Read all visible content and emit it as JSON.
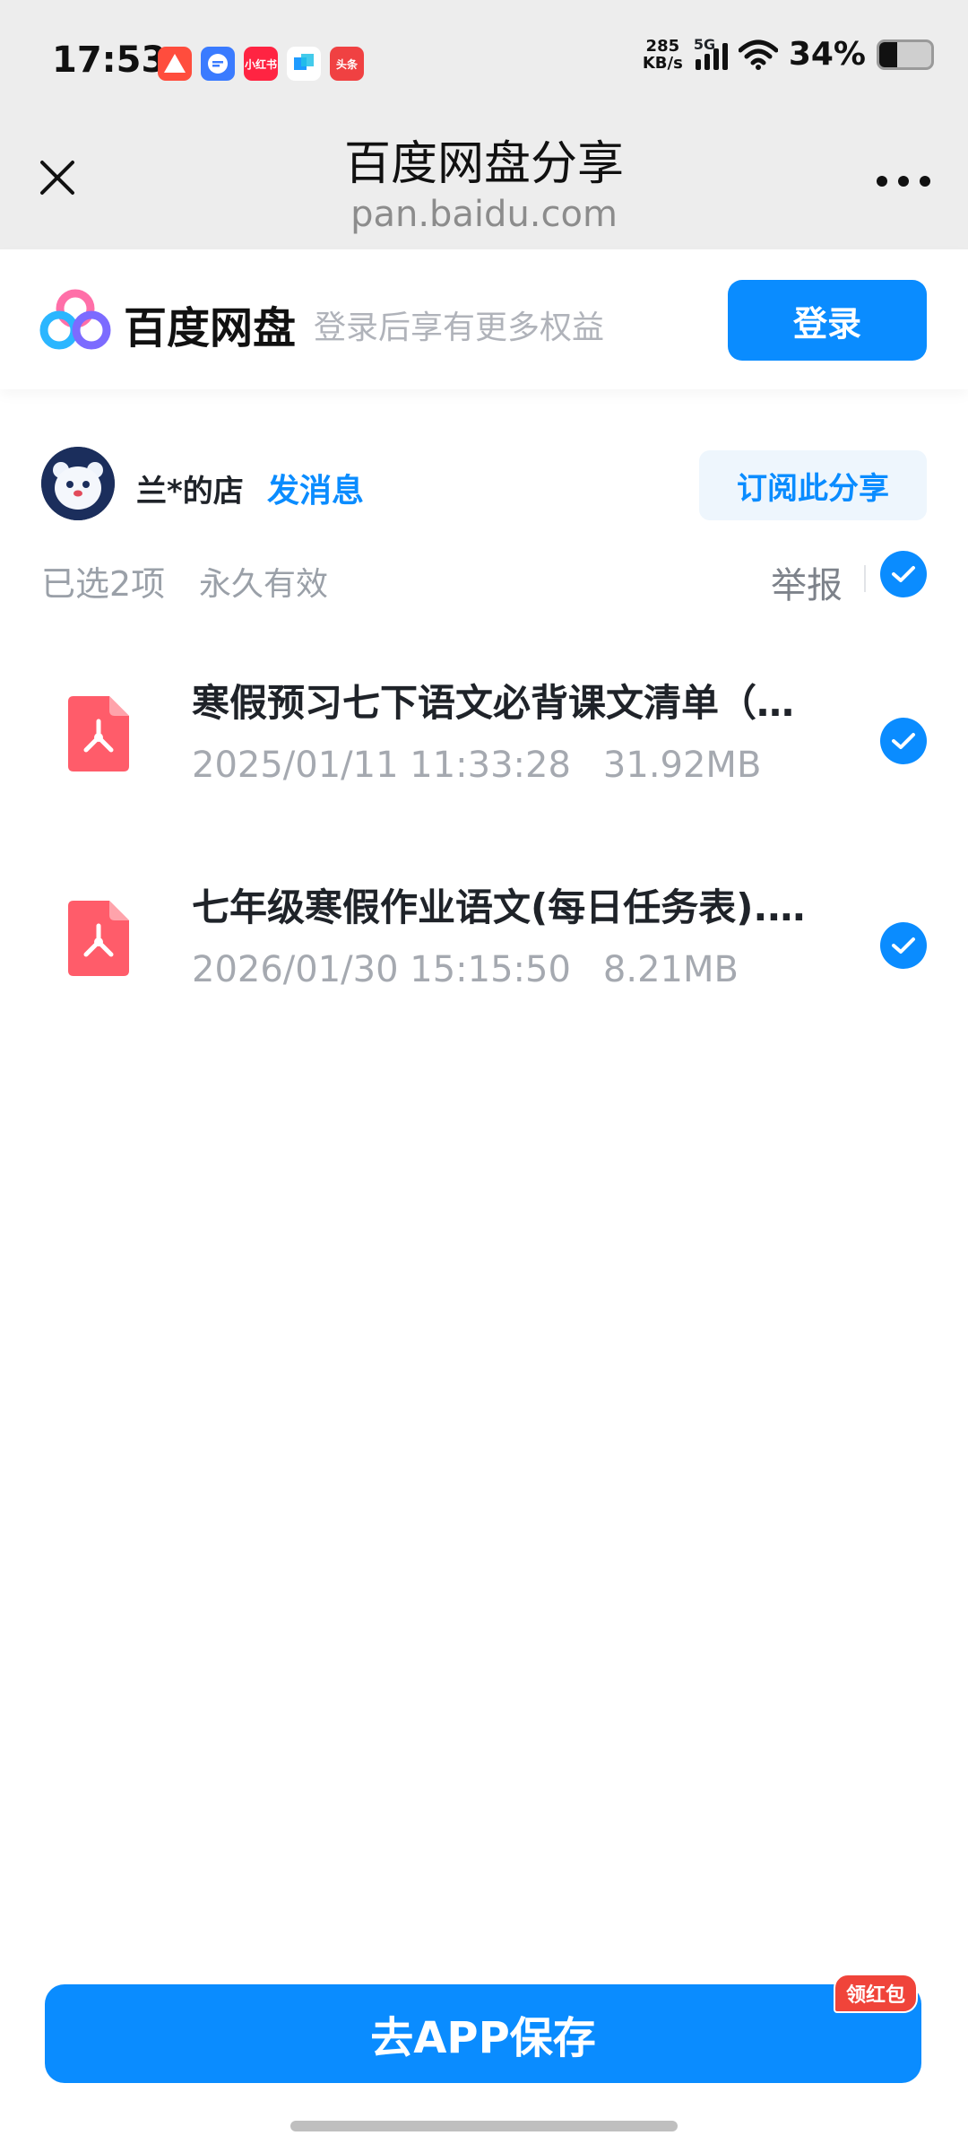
{
  "status_bar": {
    "time": "17:53",
    "app_icons": [
      {
        "name": "app-red-triangle-icon",
        "label": "",
        "color": "#ff4d3d"
      },
      {
        "name": "app-blue-chat-icon",
        "label": "",
        "color": "#3a7bff"
      },
      {
        "name": "xiaohongshu-icon",
        "label": "小红书",
        "color": "#ff2442"
      },
      {
        "name": "app-blue-square-icon",
        "label": "",
        "color": "#1e9bff"
      },
      {
        "name": "toutiao-icon",
        "label": "头条",
        "color": "#f04142"
      }
    ],
    "net_speed_value": "285",
    "net_speed_unit": "KB/s",
    "network": "5G",
    "battery_percent": "34%",
    "battery_level": 0.34
  },
  "header": {
    "title": "百度网盘分享",
    "url": "pan.baidu.com"
  },
  "brand": {
    "name": "百度网盘",
    "tagline": "登录后享有更多权益",
    "login_label": "登录",
    "accent_color": "#0a8cff"
  },
  "owner": {
    "name": "兰*的店",
    "send_message_label": "发消息",
    "subscribe_label": "订阅此分享"
  },
  "selection": {
    "selected_label": "已选2项",
    "validity": "永久有效",
    "report_label": "举报",
    "all_selected": true
  },
  "files": [
    {
      "name": "寒假预习七下语文必背课文清单（…",
      "date": "2025/01/11 11:33:28",
      "size": "31.92MB",
      "type": "pdf",
      "selected": true
    },
    {
      "name": "七年级寒假作业语文(每日任务表).…",
      "date": "2026/01/30 15:15:50",
      "size": "8.21MB",
      "type": "pdf",
      "selected": true
    }
  ],
  "footer": {
    "cta_label": "去APP保存",
    "badge_label": "领红包"
  }
}
